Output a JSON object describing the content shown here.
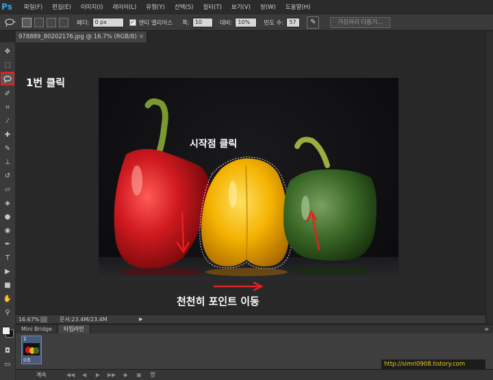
{
  "app": {
    "logo": "Ps"
  },
  "menu": [
    "파일(F)",
    "편집(E)",
    "이미지(I)",
    "레이어(L)",
    "유형(Y)",
    "선택(S)",
    "필터(T)",
    "보기(V)",
    "창(W)",
    "도움말(H)"
  ],
  "options": {
    "feather_label": "페더:",
    "feather_value": "0 px",
    "antialias_label": "앤티 앨리어스",
    "width_label": "폭:",
    "width_value": "10 px",
    "contrast_label": "대비:",
    "contrast_value": "10%",
    "frequency_label": "빈도 수:",
    "frequency_value": "57",
    "refine_edge": "가장자리 다듬기..."
  },
  "document": {
    "tab_title": "978889_80202176.jpg @ 16.7% (RGB/8)",
    "close": "×"
  },
  "annotations": {
    "step1": "1번 클릭",
    "start_point": "시작점 클릭",
    "move": "천천히 포인트 이동"
  },
  "status": {
    "zoom": "16.67%",
    "doc_size": "문서:23.4M/23.4M"
  },
  "panel": {
    "tabs": [
      "Mini Bridge",
      "타임라인"
    ],
    "frame_number": "1",
    "frame_time": "0초",
    "loop": "계속"
  },
  "watermark": "http://simri0908.tistory.com",
  "colors": {
    "annotation_red": "#e82020",
    "pepper_red": "#c8141c",
    "pepper_yellow": "#f0b400",
    "pepper_green": "#3c6a28"
  }
}
